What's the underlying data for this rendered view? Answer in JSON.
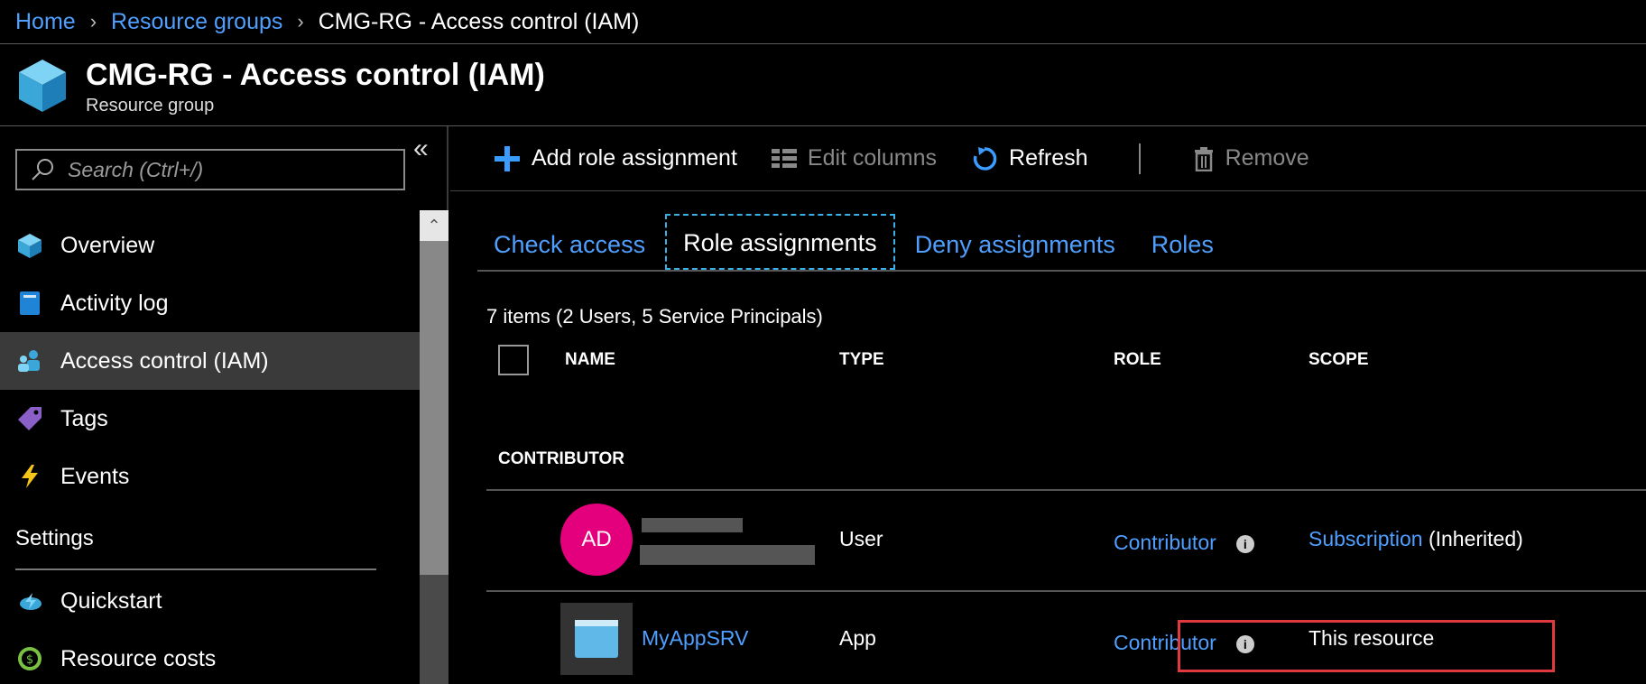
{
  "breadcrumb": {
    "home": "Home",
    "resource_groups": "Resource groups",
    "current": "CMG-RG - Access control (IAM)"
  },
  "header": {
    "title": "CMG-RG - Access control (IAM)",
    "subtitle": "Resource group"
  },
  "sidebar": {
    "search_placeholder": "Search (Ctrl+/)",
    "collapse_icon": "double-chevron-left-icon",
    "items": [
      {
        "label": "Overview",
        "icon": "overview-icon"
      },
      {
        "label": "Activity log",
        "icon": "activity-log-icon"
      },
      {
        "label": "Access control (IAM)",
        "icon": "iam-icon",
        "active": true
      },
      {
        "label": "Tags",
        "icon": "tag-icon"
      },
      {
        "label": "Events",
        "icon": "lightning-icon"
      }
    ],
    "section_settings": "Settings",
    "settings_items": [
      {
        "label": "Quickstart",
        "icon": "quickstart-icon"
      },
      {
        "label": "Resource costs",
        "icon": "cost-icon"
      }
    ]
  },
  "toolbar": {
    "add": "Add role assignment",
    "edit_columns": "Edit columns",
    "refresh": "Refresh",
    "remove": "Remove"
  },
  "tabs": [
    {
      "label": "Check access"
    },
    {
      "label": "Role assignments",
      "active": true
    },
    {
      "label": "Deny assignments"
    },
    {
      "label": "Roles"
    }
  ],
  "summary": "7 items (2 Users, 5 Service Principals)",
  "columns": {
    "name": "NAME",
    "type": "TYPE",
    "role": "ROLE",
    "scope": "SCOPE"
  },
  "group_label": "CONTRIBUTOR",
  "rows": [
    {
      "avatar": "AD",
      "type": "User",
      "role": "Contributor",
      "scope_link": "Subscription",
      "scope_suffix": "(Inherited)"
    },
    {
      "name": "MyAppSRV",
      "type": "App",
      "role": "Contributor",
      "scope": "This resource"
    }
  ],
  "colors": {
    "link": "#4f9fff",
    "accent": "#3bb0e6",
    "avatar": "#e4007c",
    "highlight": "#e0393e"
  }
}
